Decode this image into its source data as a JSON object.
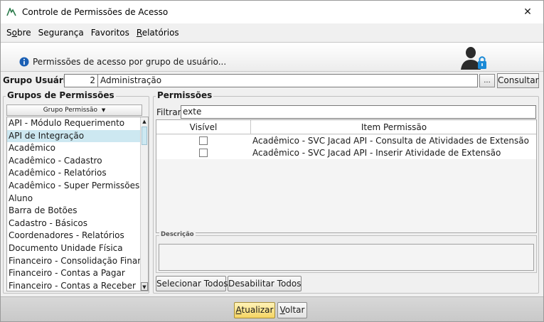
{
  "window": {
    "title": "Controle de Permissões de Acesso",
    "close_glyph": "✕"
  },
  "menu": [
    {
      "label": "Sobre",
      "mnemonic_index": 1
    },
    {
      "label": "Segurança",
      "mnemonic_index": -1
    },
    {
      "label": "Favoritos",
      "mnemonic_index": -1
    },
    {
      "label": "Relatórios",
      "mnemonic_index": 0
    }
  ],
  "info": {
    "icon": "info-icon",
    "text": "Permissões de acesso por grupo de usuário...",
    "right_icon": "user-lock-icon"
  },
  "group": {
    "label": "Grupo Usuário:",
    "id_value": "2",
    "name_value": "Administração",
    "ellipsis_label": "...",
    "consultar_label": "Consultar"
  },
  "left_panel": {
    "legend": "Grupos de Permissões",
    "column_header": "Grupo Permissão",
    "sort_icon": "sort-desc-icon",
    "items": [
      {
        "label": "API - Módulo Requerimento",
        "selected": false
      },
      {
        "label": "API de Integração",
        "selected": true
      },
      {
        "label": "Acadêmico",
        "selected": false
      },
      {
        "label": "Acadêmico - Cadastro",
        "selected": false
      },
      {
        "label": "Acadêmico - Relatórios",
        "selected": false
      },
      {
        "label": "Acadêmico - Super Permissões",
        "selected": false
      },
      {
        "label": "Aluno",
        "selected": false
      },
      {
        "label": "Barra de Botões",
        "selected": false
      },
      {
        "label": "Cadastro - Básicos",
        "selected": false
      },
      {
        "label": "Coordenadores - Relatórios",
        "selected": false
      },
      {
        "label": "Documento Unidade Física",
        "selected": false
      },
      {
        "label": "Financeiro - Consolidação Financ...",
        "selected": false
      },
      {
        "label": "Financeiro - Contas a Pagar",
        "selected": false
      },
      {
        "label": "Financeiro - Contas a Receber",
        "selected": false
      }
    ]
  },
  "right_panel": {
    "legend": "Permissões",
    "filter_label": "Filtrar:",
    "filter_value": "exte",
    "columns": {
      "visible": "Visível",
      "item": "Item Permissão"
    },
    "rows": [
      {
        "visible": false,
        "item": "Acadêmico - SVC Jacad API - Consulta de Atividades de Extensão"
      },
      {
        "visible": false,
        "item": "Acadêmico - SVC Jacad API - Inserir Atividade de Extensão"
      }
    ],
    "description_legend": "Descrição",
    "description_value": "",
    "select_all_label": "Selecionar Todos",
    "disable_all_label": "Desabilitar Todos"
  },
  "footer": {
    "atualizar_label": "Atualizar",
    "voltar_label": "Voltar"
  },
  "colors": {
    "selected_row": "#cde8f1",
    "primary_button": "#f5d463",
    "info_icon": "#1a5fb4"
  }
}
